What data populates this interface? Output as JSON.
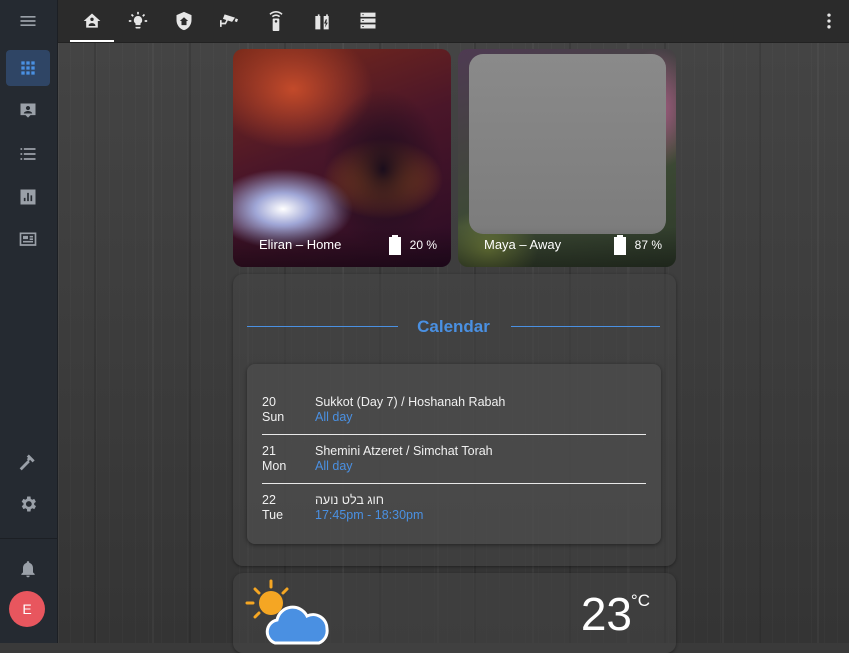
{
  "topbar": {
    "tabs": [
      {
        "icon": "home-account-icon",
        "active": true
      },
      {
        "icon": "lightbulb-icon",
        "active": false
      },
      {
        "icon": "shield-home-icon",
        "active": false
      },
      {
        "icon": "cctv-icon",
        "active": false
      },
      {
        "icon": "remote-icon",
        "active": false
      },
      {
        "icon": "battery-charging-icon",
        "active": false
      },
      {
        "icon": "server-icon",
        "active": false
      }
    ],
    "menu_icon": "dots-vertical-icon"
  },
  "sidebar": {
    "menu_icon": "hamburger-icon",
    "items": [
      {
        "icon": "grid-icon",
        "active": true
      },
      {
        "icon": "account-box-icon",
        "active": false
      },
      {
        "icon": "list-icon",
        "active": false
      },
      {
        "icon": "chart-icon",
        "active": false
      },
      {
        "icon": "monitor-dashboard-icon",
        "active": false
      }
    ],
    "bottom_items": [
      {
        "icon": "hammer-icon"
      },
      {
        "icon": "gear-icon"
      },
      {
        "icon": "bell-icon"
      }
    ],
    "avatar": {
      "initial": "E",
      "color": "#e8565e"
    }
  },
  "persons": [
    {
      "name": "Eliran – Home",
      "battery": "20 %"
    },
    {
      "name": "Maya – Away",
      "battery": "87 %"
    }
  ],
  "calendar": {
    "title": "Calendar",
    "events": [
      {
        "day": "20",
        "weekday": "Sun",
        "summary": "Sukkot (Day 7) / Hoshanah Rabah",
        "time": "All day"
      },
      {
        "day": "21",
        "weekday": "Mon",
        "summary": "Shemini Atzeret / Simchat Torah",
        "time": "All day"
      },
      {
        "day": "22",
        "weekday": "Tue",
        "summary": "חוג בלט נועה",
        "time": "17:45pm - 18:30pm"
      }
    ]
  },
  "weather": {
    "temperature": "23",
    "unit": "°C",
    "icon": "partly-cloudy-sun-icon"
  },
  "colors": {
    "accent": "#4a90e2",
    "sidebar": "#252a31",
    "topbar": "#2b2b2b",
    "avatar": "#e8565e"
  }
}
